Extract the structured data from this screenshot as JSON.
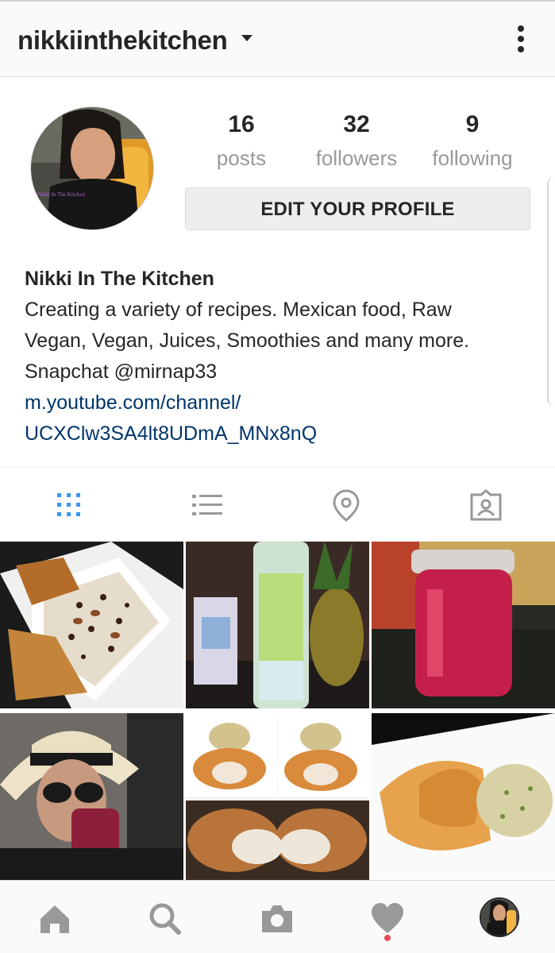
{
  "header": {
    "username": "nikkiinthekitchen",
    "dropdown_icon": "chevron-down-icon",
    "more_icon": "more-vertical-icon"
  },
  "profile": {
    "avatar_caption": "Nikki In The Kitchen",
    "stats": [
      {
        "value": "16",
        "label": "posts"
      },
      {
        "value": "32",
        "label": "followers"
      },
      {
        "value": "9",
        "label": "following"
      }
    ],
    "edit_button": "EDIT YOUR PROFILE"
  },
  "bio": {
    "name": "Nikki In The Kitchen",
    "lines": [
      "Creating a variety of recipes. Mexican food, Raw",
      "Vegan, Vegan, Juices, Smoothies and many more.",
      "Snapchat @mirnap33"
    ],
    "link_lines": [
      "m.youtube.com/channel/",
      "UCXClw3SA4lt8UDmA_MNx8nQ"
    ]
  },
  "tabs": [
    {
      "icon": "grid-icon",
      "active": true
    },
    {
      "icon": "list-icon",
      "active": false
    },
    {
      "icon": "location-pin-icon",
      "active": false
    },
    {
      "icon": "tagged-photos-icon",
      "active": false
    }
  ],
  "posts": [
    {
      "subject": "oatmeal with raisins and toast"
    },
    {
      "subject": "fruit infused water and pineapple"
    },
    {
      "subject": "red juice in mason jar"
    },
    {
      "subject": "woman in hat drinking juice"
    },
    {
      "subject": "stuffed chicken with rice"
    },
    {
      "subject": "chicken with sauce and rice"
    }
  ],
  "bottom_nav": [
    {
      "icon": "home-icon"
    },
    {
      "icon": "search-icon"
    },
    {
      "icon": "camera-icon"
    },
    {
      "icon": "heart-icon",
      "notification": true
    },
    {
      "icon": "profile-avatar-icon"
    }
  ],
  "colors": {
    "active_tab": "#3897f0",
    "inactive_icon": "#999999",
    "link": "#003569",
    "notification": "#ed4956"
  }
}
